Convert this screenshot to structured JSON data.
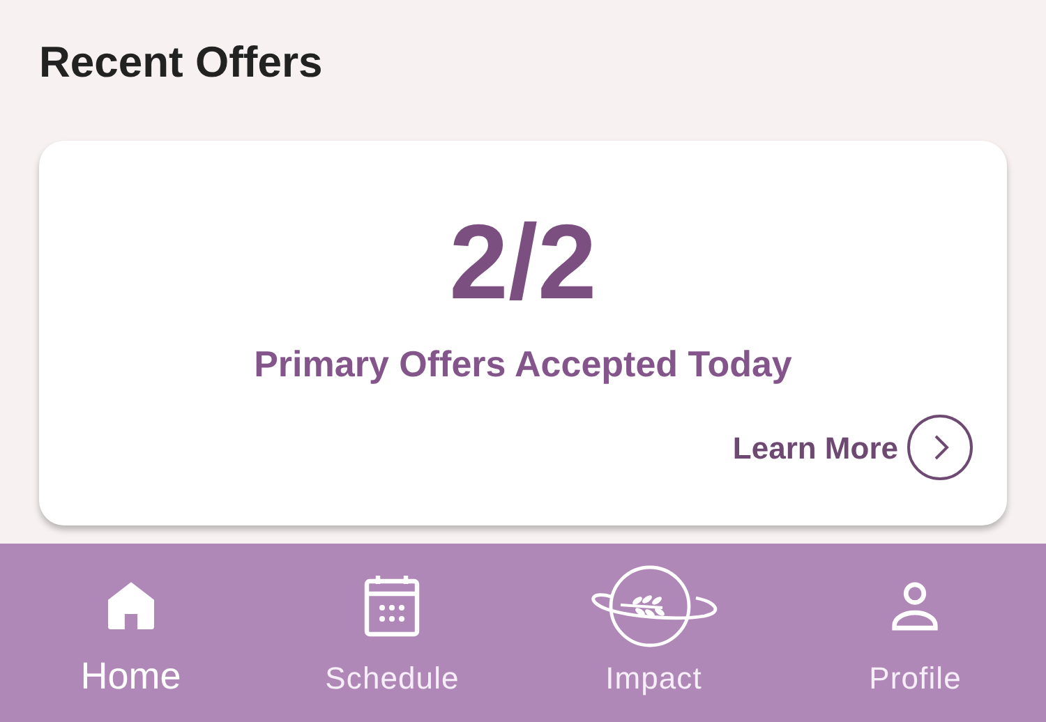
{
  "section_title": "Recent Offers",
  "offer_card": {
    "count": "2/2",
    "caption": "Primary Offers Accepted Today",
    "link": "Learn More"
  },
  "nav": [
    {
      "kind": "home",
      "label": "Home",
      "selected": true
    },
    {
      "kind": "schedule",
      "label": "Schedule",
      "selected": false
    },
    {
      "kind": "impact",
      "label": "Impact",
      "selected": false
    },
    {
      "kind": "profile",
      "label": "Profile",
      "selected": false
    }
  ]
}
